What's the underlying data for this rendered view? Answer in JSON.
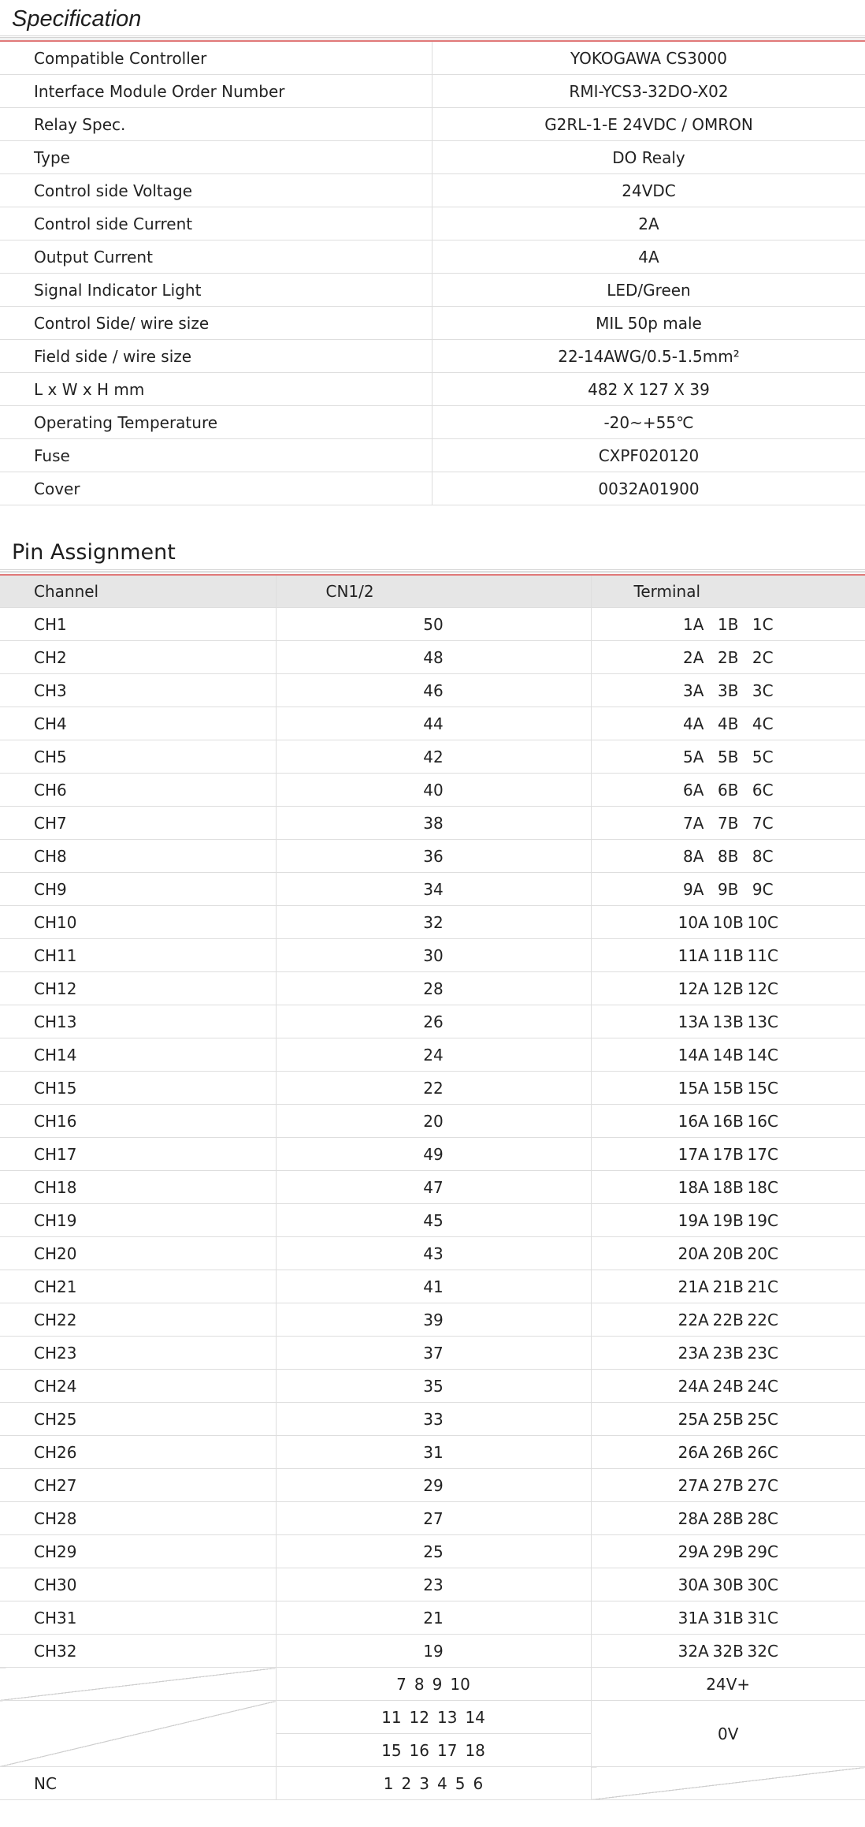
{
  "specification": {
    "title": "Specification",
    "rows": [
      {
        "label": "Compatible Controller",
        "value": "YOKOGAWA  CS3000"
      },
      {
        "label": "Interface Module Order Number",
        "value": "RMI-YCS3-32DO-X02"
      },
      {
        "label": "Relay Spec.",
        "value": "G2RL-1-E  24VDC / OMRON"
      },
      {
        "label": "Type",
        "value": "DO Realy"
      },
      {
        "label": "Control side Voltage",
        "value": "24VDC"
      },
      {
        "label": "Control side Current",
        "value": "2A"
      },
      {
        "label": "Output Current",
        "value": "4A"
      },
      {
        "label": "Signal Indicator Light",
        "value": "LED/Green"
      },
      {
        "label": "Control Side/ wire size",
        "value": "MIL  50p  male"
      },
      {
        "label": "Field side / wire size",
        "value": "22-14AWG/0.5-1.5mm²"
      },
      {
        "label": "L x W x H mm",
        "value": "482 X 127 X 39"
      },
      {
        "label": "Operating Temperature",
        "value": "-20~+55℃"
      },
      {
        "label": "Fuse",
        "value": "CXPF020120"
      },
      {
        "label": "Cover",
        "value": "0032A01900"
      }
    ]
  },
  "pin_assignment": {
    "title": "Pin Assignment",
    "headers": {
      "channel": "Channel",
      "cn": "CN1/2",
      "terminal": "Terminal"
    },
    "rows": [
      {
        "channel": "CH1",
        "cn": "50",
        "terminal": [
          "1A",
          "1B",
          "1C"
        ]
      },
      {
        "channel": "CH2",
        "cn": "48",
        "terminal": [
          "2A",
          "2B",
          "2C"
        ]
      },
      {
        "channel": "CH3",
        "cn": "46",
        "terminal": [
          "3A",
          "3B",
          "3C"
        ]
      },
      {
        "channel": "CH4",
        "cn": "44",
        "terminal": [
          "4A",
          "4B",
          "4C"
        ]
      },
      {
        "channel": "CH5",
        "cn": "42",
        "terminal": [
          "5A",
          "5B",
          "5C"
        ]
      },
      {
        "channel": "CH6",
        "cn": "40",
        "terminal": [
          "6A",
          "6B",
          "6C"
        ]
      },
      {
        "channel": "CH7",
        "cn": "38",
        "terminal": [
          "7A",
          "7B",
          "7C"
        ]
      },
      {
        "channel": "CH8",
        "cn": "36",
        "terminal": [
          "8A",
          "8B",
          "8C"
        ]
      },
      {
        "channel": "CH9",
        "cn": "34",
        "terminal": [
          "9A",
          "9B",
          "9C"
        ]
      },
      {
        "channel": "CH10",
        "cn": "32",
        "terminal": [
          "10A",
          "10B",
          "10C"
        ]
      },
      {
        "channel": "CH11",
        "cn": "30",
        "terminal": [
          "11A",
          "11B",
          "11C"
        ]
      },
      {
        "channel": "CH12",
        "cn": "28",
        "terminal": [
          "12A",
          "12B",
          "12C"
        ]
      },
      {
        "channel": "CH13",
        "cn": "26",
        "terminal": [
          "13A",
          "13B",
          "13C"
        ]
      },
      {
        "channel": "CH14",
        "cn": "24",
        "terminal": [
          "14A",
          "14B",
          "14C"
        ]
      },
      {
        "channel": "CH15",
        "cn": "22",
        "terminal": [
          "15A",
          "15B",
          "15C"
        ]
      },
      {
        "channel": "CH16",
        "cn": "20",
        "terminal": [
          "16A",
          "16B",
          "16C"
        ]
      },
      {
        "channel": "CH17",
        "cn": "49",
        "terminal": [
          "17A",
          "17B",
          "17C"
        ]
      },
      {
        "channel": "CH18",
        "cn": "47",
        "terminal": [
          "18A",
          "18B",
          "18C"
        ]
      },
      {
        "channel": "CH19",
        "cn": "45",
        "terminal": [
          "19A",
          "19B",
          "19C"
        ]
      },
      {
        "channel": "CH20",
        "cn": "43",
        "terminal": [
          "20A",
          "20B",
          "20C"
        ]
      },
      {
        "channel": "CH21",
        "cn": "41",
        "terminal": [
          "21A",
          "21B",
          "21C"
        ]
      },
      {
        "channel": "CH22",
        "cn": "39",
        "terminal": [
          "22A",
          "22B",
          "22C"
        ]
      },
      {
        "channel": "CH23",
        "cn": "37",
        "terminal": [
          "23A",
          "23B",
          "23C"
        ]
      },
      {
        "channel": "CH24",
        "cn": "35",
        "terminal": [
          "24A",
          "24B",
          "24C"
        ]
      },
      {
        "channel": "CH25",
        "cn": "33",
        "terminal": [
          "25A",
          "25B",
          "25C"
        ]
      },
      {
        "channel": "CH26",
        "cn": "31",
        "terminal": [
          "26A",
          "26B",
          "26C"
        ]
      },
      {
        "channel": "CH27",
        "cn": "29",
        "terminal": [
          "27A",
          "27B",
          "27C"
        ]
      },
      {
        "channel": "CH28",
        "cn": "27",
        "terminal": [
          "28A",
          "28B",
          "28C"
        ]
      },
      {
        "channel": "CH29",
        "cn": "25",
        "terminal": [
          "29A",
          "29B",
          "29C"
        ]
      },
      {
        "channel": "CH30",
        "cn": "23",
        "terminal": [
          "30A",
          "30B",
          "30C"
        ]
      },
      {
        "channel": "CH31",
        "cn": "21",
        "terminal": [
          "31A",
          "31B",
          "31C"
        ]
      },
      {
        "channel": "CH32",
        "cn": "19",
        "terminal": [
          "32A",
          "32B",
          "32C"
        ]
      }
    ],
    "power": {
      "v24_pins": [
        "7",
        "8",
        "9",
        "10"
      ],
      "v24_label": "24V+",
      "v0_pins_a": [
        "11",
        "12",
        "13",
        "14"
      ],
      "v0_pins_b": [
        "15",
        "16",
        "17",
        "18"
      ],
      "v0_label": "0V",
      "nc_label": "NC",
      "nc_pins": [
        "1",
        "2",
        "3",
        "4",
        "5",
        "6"
      ]
    }
  }
}
